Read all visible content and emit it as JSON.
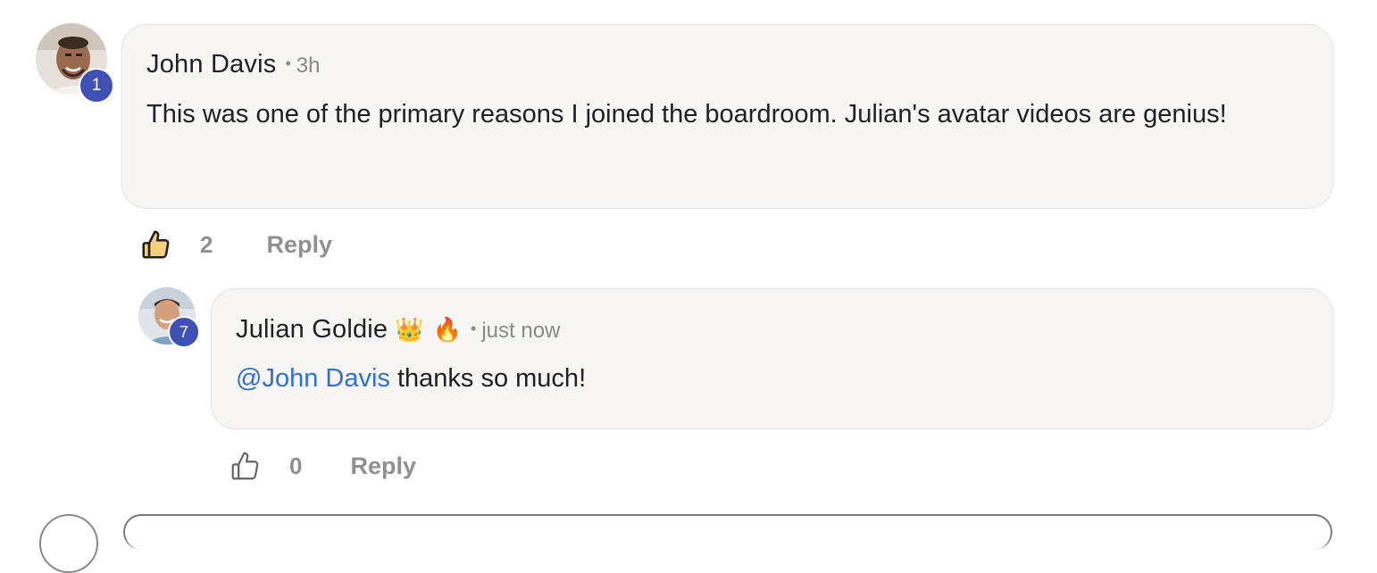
{
  "comments": [
    {
      "author": "John Davis",
      "time": "3h",
      "level": "1",
      "text": "This was one of the primary reasons I joined the boardroom. Julian's avatar videos are genius!",
      "likes": "2",
      "reply_label": "Reply",
      "liked": true
    }
  ],
  "reply": {
    "author": "Julian Goldie",
    "badges": [
      "👑",
      "🔥"
    ],
    "time": "just now",
    "level": "7",
    "mention": "@John Davis",
    "text": " thanks so much!",
    "likes": "0",
    "reply_label": "Reply",
    "liked": false
  },
  "colors": {
    "badge": "#3f51b5",
    "mention": "#2f6ed8",
    "liked_thumb": "#f6cf7a",
    "bubble_bg": "#f7f6f5"
  },
  "icons": {
    "like": "thumbs-up-icon",
    "crown": "crown-emoji",
    "fire": "fire-emoji"
  }
}
